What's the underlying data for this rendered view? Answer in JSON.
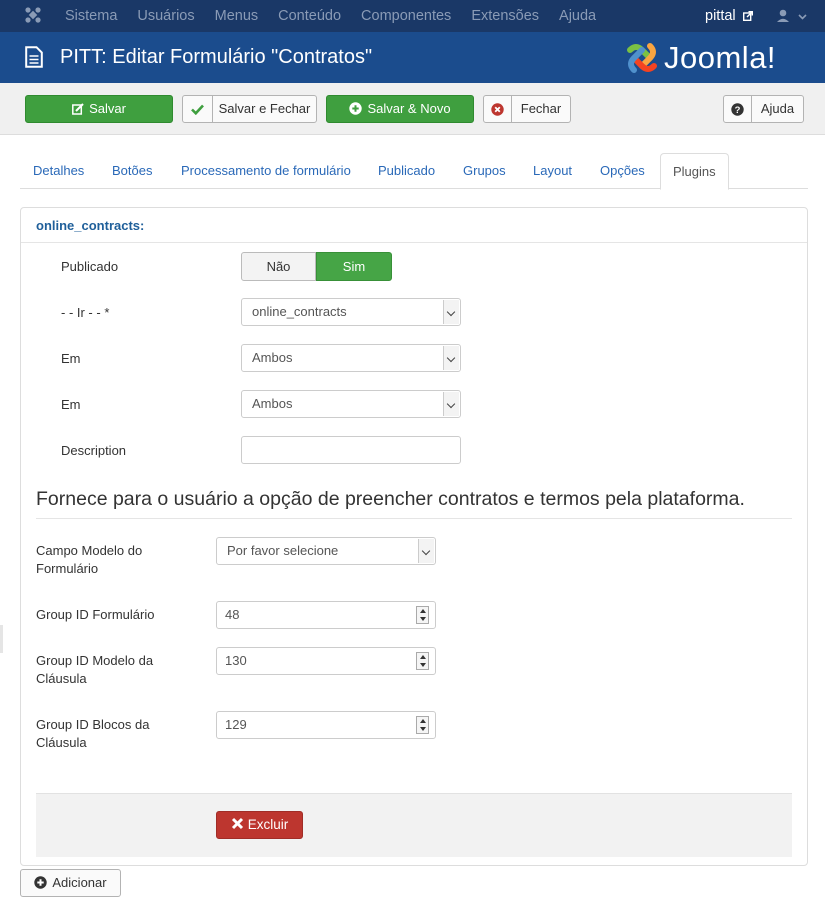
{
  "topbar": {
    "menu": [
      "Sistema",
      "Usuários",
      "Menus",
      "Conteúdo",
      "Componentes",
      "Extensões",
      "Ajuda"
    ],
    "user": "pittal"
  },
  "header": {
    "title": "PITT: Editar Formulário \"Contratos\"",
    "brand": "Joomla!"
  },
  "toolbar": {
    "save": "Salvar",
    "save_close": "Salvar e Fechar",
    "save_new": "Salvar & Novo",
    "close": "Fechar",
    "help": "Ajuda"
  },
  "tabs": [
    "Detalhes",
    "Botões",
    "Processamento de formulário",
    "Publicado",
    "Grupos",
    "Layout",
    "Opções",
    "Plugins"
  ],
  "panel": {
    "title": "online_contracts:",
    "published_label": "Publicado",
    "toggle_off": "Não",
    "toggle_on": "Sim",
    "go_label": "- - Ir - - *",
    "go_value": "online_contracts",
    "em1_label": "Em",
    "em1_value": "Ambos",
    "em2_label": "Em",
    "em2_value": "Ambos",
    "description_label": "Description",
    "description_value": "",
    "plugin_description": "Fornece para o usuário a opção de preencher contratos e termos pela plataforma.",
    "campo_modelo_label": "Campo Modelo do Formulário",
    "campo_modelo_value": "Por favor selecione",
    "group_form_label": "Group ID Formulário",
    "group_form_value": "48",
    "group_clause_model_label": "Group ID Modelo da Cláusula",
    "group_clause_model_value": "130",
    "group_clause_blocks_label": "Group ID Blocos da Cláusula",
    "group_clause_blocks_value": "129",
    "delete": "Excluir"
  },
  "add_button": "Adicionar",
  "colors": {
    "topbar": "#1a3867",
    "header": "#1b4c8d",
    "green": "#46a546",
    "red": "#bd362f",
    "link": "#2a69b8"
  }
}
